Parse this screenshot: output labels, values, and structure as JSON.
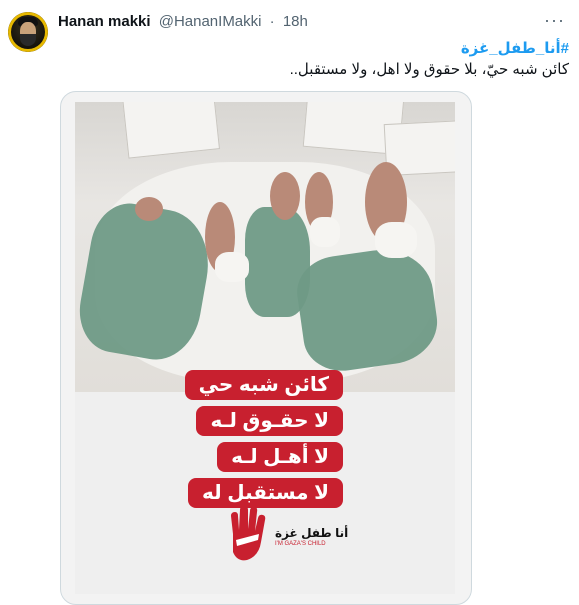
{
  "tweet": {
    "author_name": "Hanan makki",
    "handle": "@HananIMakki",
    "separator": "·",
    "time": "18h",
    "more_icon": "more-horizontal-icon",
    "hashtag": "#أنا_طفل_غزة",
    "text": "كائن شبه حيّ، بلا حقوق ولا اهل، ولا مستقبل..",
    "avatar": "avatar"
  },
  "media": {
    "captions": [
      "كائن شبه حي",
      "لا حقـوق لـه",
      "لا أهـل لـه",
      "لا مستقبل له"
    ],
    "logo_title": "أنا طفل غزة",
    "logo_sub": "I'M GAZA'S CHILD",
    "caption_color": "#c8202f"
  },
  "colors": {
    "link": "#1d9bf0",
    "muted": "#536471",
    "border": "#cfd9de"
  }
}
